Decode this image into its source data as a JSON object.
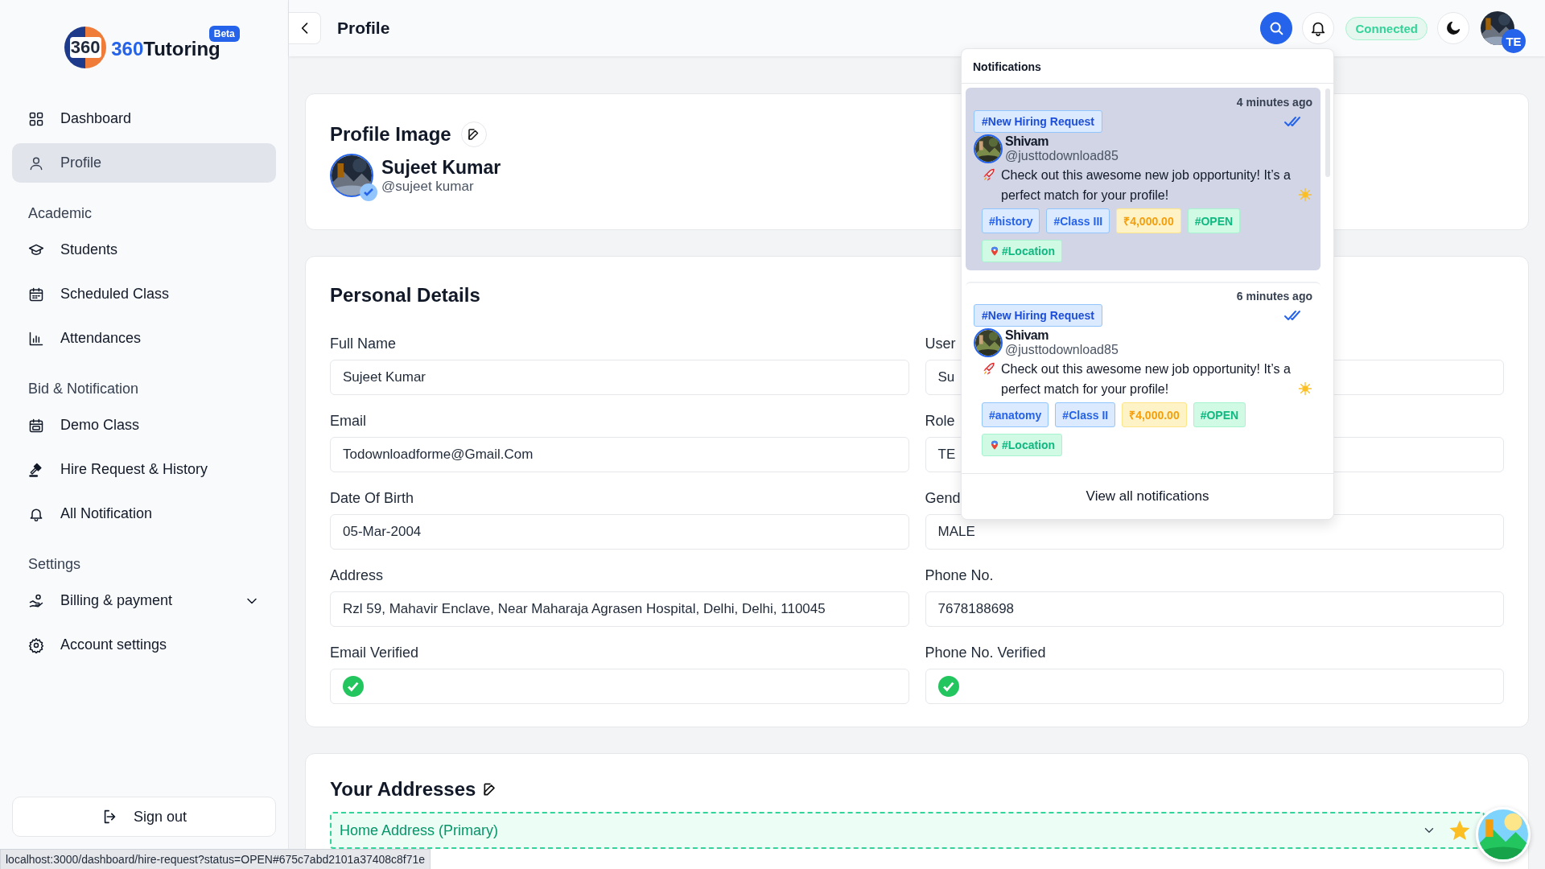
{
  "sidebar": {
    "logo": {
      "mark": "360",
      "brand_prefix": "360",
      "brand_name": "Tutoring",
      "badge": "Beta"
    },
    "sections": [
      {
        "items": [
          {
            "label": "Dashboard",
            "selected": false
          },
          {
            "label": "Profile",
            "selected": true
          }
        ]
      },
      {
        "title": "Academic",
        "items": [
          {
            "label": "Students",
            "selected": false
          },
          {
            "label": "Scheduled Class",
            "selected": false
          },
          {
            "label": "Attendances",
            "selected": false
          }
        ]
      },
      {
        "title": "Bid & Notification",
        "items": [
          {
            "label": "Demo Class",
            "selected": false
          },
          {
            "label": "Hire Request & History",
            "selected": false
          },
          {
            "label": "All Notification",
            "selected": false
          }
        ]
      },
      {
        "title": "Settings",
        "items": [
          {
            "label": "Billing & payment",
            "selected": false,
            "expandable": true
          },
          {
            "label": "Account settings",
            "selected": false
          }
        ]
      }
    ],
    "sign_out": "Sign out"
  },
  "header": {
    "title": "Profile",
    "connection": "Connected",
    "avatar_badge": "TE"
  },
  "profile_image": {
    "title": "Profile Image",
    "name": "Sujeet Kumar",
    "handle": "@sujeet kumar",
    "verified": true
  },
  "personal_details": {
    "title": "Personal Details",
    "fields": [
      {
        "label": "Full Name",
        "kind": "text",
        "value": "Sujeet Kumar"
      },
      {
        "label": "User",
        "kind": "text",
        "value": "Su"
      },
      {
        "label": "Email",
        "kind": "text",
        "value": "Todownloadforme@Gmail.Com"
      },
      {
        "label": "Role",
        "kind": "text",
        "value": "TE"
      },
      {
        "label": "Date Of Birth",
        "kind": "text",
        "value": "05-Mar-2004"
      },
      {
        "label": "Gend",
        "kind": "text",
        "value": "MALE"
      },
      {
        "label": "Address",
        "kind": "text",
        "value": "Rzl 59, Mahavir Enclave, Near Maharaja Agrasen Hospital, Delhi, Delhi, 110045"
      },
      {
        "label": "Phone No.",
        "kind": "text",
        "value": "7678188698"
      },
      {
        "label": "Email Verified",
        "kind": "check",
        "checked": true
      },
      {
        "label": "Phone No. Verified",
        "kind": "check",
        "checked": true
      }
    ]
  },
  "addresses": {
    "title": "Your Addresses",
    "items": [
      {
        "label": "Home Address (Primary)",
        "primary": true,
        "expanded": false
      }
    ]
  },
  "notifications": {
    "title": "Notifications",
    "items": [
      {
        "time": "4 minutes ago",
        "type_tag": "#New Hiring Request",
        "read": true,
        "highlighted": true,
        "name": "Shivam",
        "handle": "@justtodownload85",
        "message": "Check out this awesome new job opportunity! It’s a perfect match for your profile!",
        "tags": [
          {
            "kind": "subject",
            "text": "#history"
          },
          {
            "kind": "class",
            "text": "#Class III"
          },
          {
            "kind": "price",
            "text": "₹4,000.00"
          },
          {
            "kind": "status",
            "text": "#OPEN"
          },
          {
            "kind": "location",
            "text": "#Location"
          }
        ]
      },
      {
        "time": "6 minutes ago",
        "type_tag": "#New Hiring Request",
        "read": true,
        "highlighted": false,
        "name": "Shivam",
        "handle": "@justtodownload85",
        "message": "Check out this awesome new job opportunity! It’s a perfect match for your profile!",
        "tags": [
          {
            "kind": "subject",
            "text": "#anatomy"
          },
          {
            "kind": "class",
            "text": "#Class II"
          },
          {
            "kind": "price",
            "text": "₹4,000.00"
          },
          {
            "kind": "status",
            "text": "#OPEN"
          },
          {
            "kind": "location",
            "text": "#Location"
          }
        ]
      }
    ],
    "footer": "View all notifications"
  },
  "status_url": "localhost:3000/dashboard/hire-request?status=OPEN#675c7abd2101a37408c8f71e"
}
